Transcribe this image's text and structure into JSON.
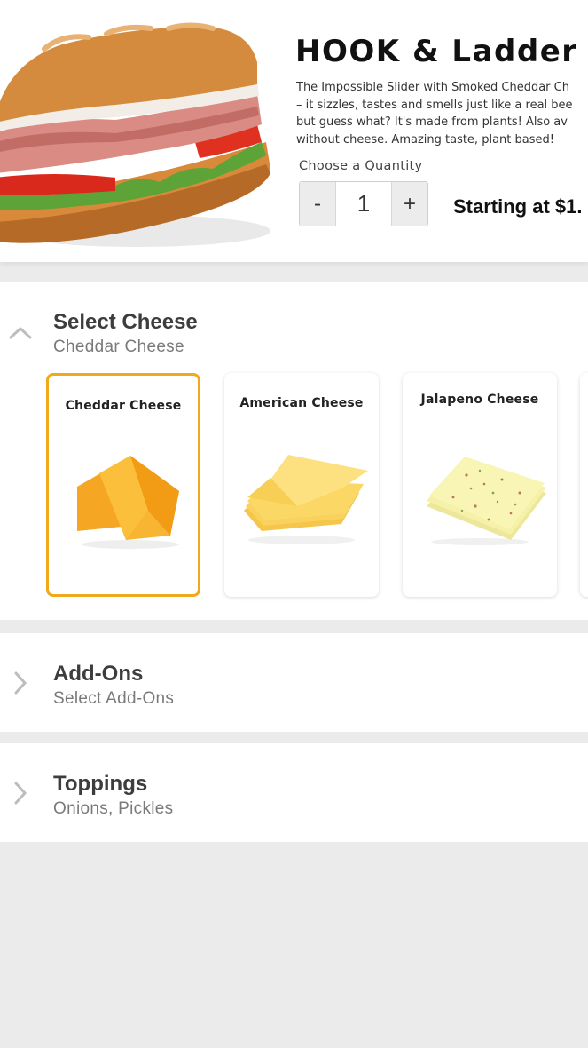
{
  "product": {
    "title": "HOOK & Ladder",
    "description_lines": [
      "The Impossible Slider with Smoked Cheddar Ch",
      "– it sizzles, tastes and smells just like a real bee",
      "but guess what? It's made from plants! Also av",
      "without cheese. Amazing taste, plant based!"
    ],
    "image_icon": "sandwich-image"
  },
  "quantity": {
    "label": "Choose a Quantity",
    "minus": "-",
    "value": "1",
    "plus": "+"
  },
  "price": "Starting at $1.",
  "sections": {
    "cheese": {
      "title": "Select Cheese",
      "subtitle": "Cheddar Cheese",
      "expanded": true,
      "chevron_icon": "chevron-up-icon",
      "options": [
        {
          "label": "Cheddar Cheese",
          "selected": true
        },
        {
          "label": "American Cheese",
          "selected": false
        },
        {
          "label": "Jalapeno Cheese",
          "selected": false
        }
      ]
    },
    "addons": {
      "title": "Add-Ons",
      "subtitle": "Select Add-Ons",
      "expanded": false,
      "chevron_icon": "chevron-right-icon"
    },
    "toppings": {
      "title": "Toppings",
      "subtitle": "Onions, Pickles",
      "expanded": false,
      "chevron_icon": "chevron-right-icon"
    }
  },
  "colors": {
    "selected_border": "#f1a91b",
    "page_background": "#ebebeb"
  }
}
